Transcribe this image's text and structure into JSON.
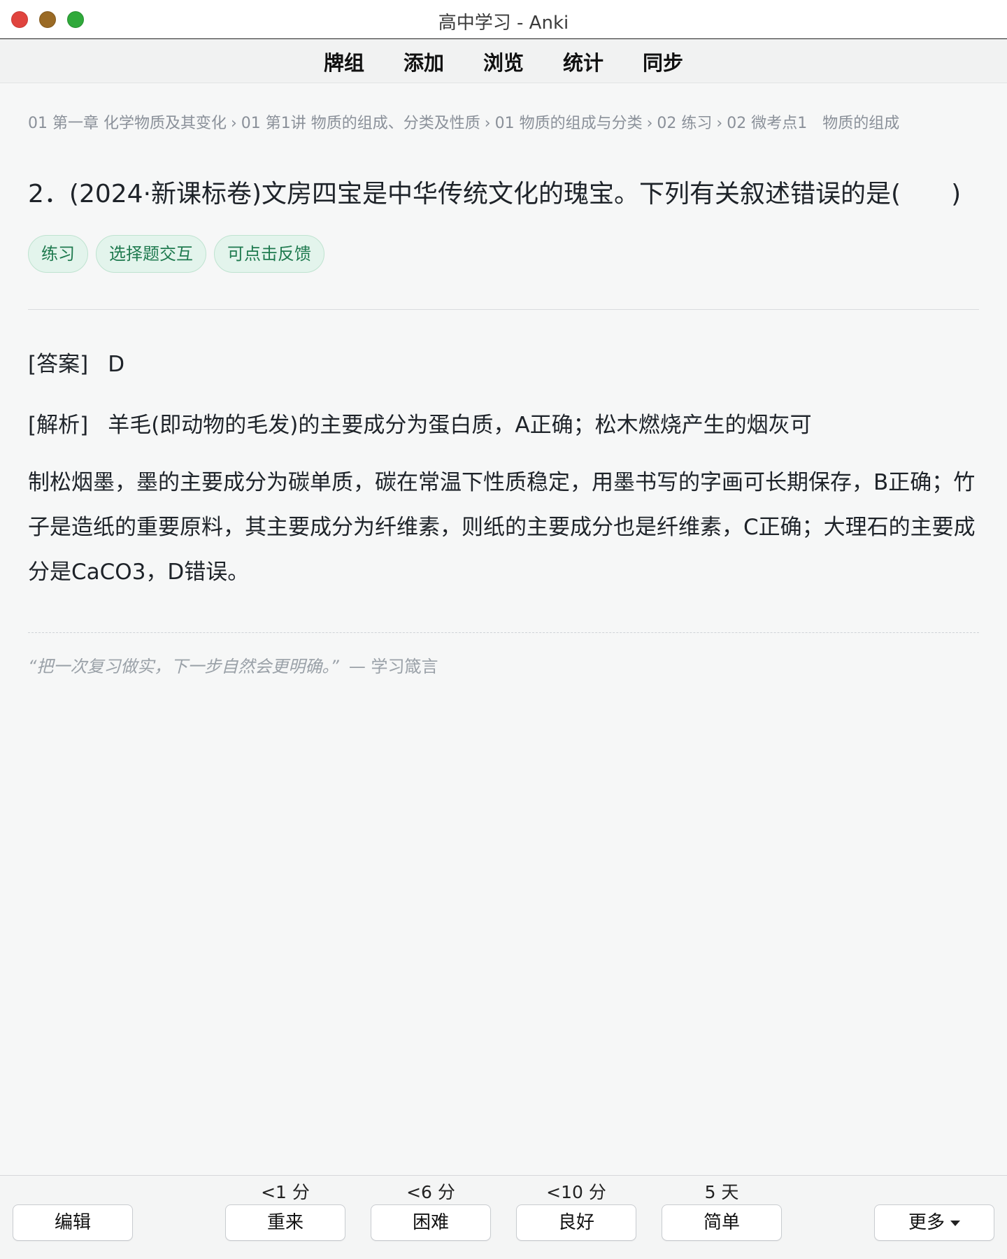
{
  "window": {
    "title": "高中学习 - Anki"
  },
  "toolbar": {
    "items": [
      "牌组",
      "添加",
      "浏览",
      "统计",
      "同步"
    ]
  },
  "breadcrumb": [
    "01 第一章 化学物质及其变化",
    "01 第1讲 物质的组成、分类及性质",
    "01 物质的组成与分类",
    "02 练习",
    "02 微考点1　物质的组成"
  ],
  "breadcrumb_separator": "›",
  "card": {
    "question": "2．(2024·新课标卷)文房四宝是中华传统文化的瑰宝。下列有关叙述错误的是(　　)",
    "tags": [
      "练习",
      "选择题交互",
      "可点击反馈"
    ],
    "answer_label": "[答案]",
    "answer_value": "D",
    "analysis_label": "[解析]",
    "analysis_first": "羊毛(即动物的毛发)的主要成分为蛋白质，A正确；松木燃烧产生的烟灰可",
    "analysis_rest": "制松烟墨，墨的主要成分为碳单质，碳在常温下性质稳定，用墨书写的字画可长期保存，B正确；竹子是造纸的重要原料，其主要成分为纤维素，则纸的主要成分也是纤维素，C正确；大理石的主要成分是CaCO3，D错误。",
    "motto": "“把一次复习做实，下一步自然会更明确。”",
    "motto_author": "— 学习箴言"
  },
  "bottom": {
    "edit_label": "编辑",
    "more_label": "更多",
    "answers": [
      {
        "label": "重来",
        "interval": "<1 分"
      },
      {
        "label": "困难",
        "interval": "<6 分"
      },
      {
        "label": "良好",
        "interval": "<10 分"
      },
      {
        "label": "简单",
        "interval": "5 天"
      }
    ]
  },
  "colors": {
    "tag_bg": "#e3f4ec",
    "tag_text": "#1f7a4f",
    "close": "#e0443e",
    "minimize": "#9a6a25",
    "zoom": "#2fa93a"
  }
}
